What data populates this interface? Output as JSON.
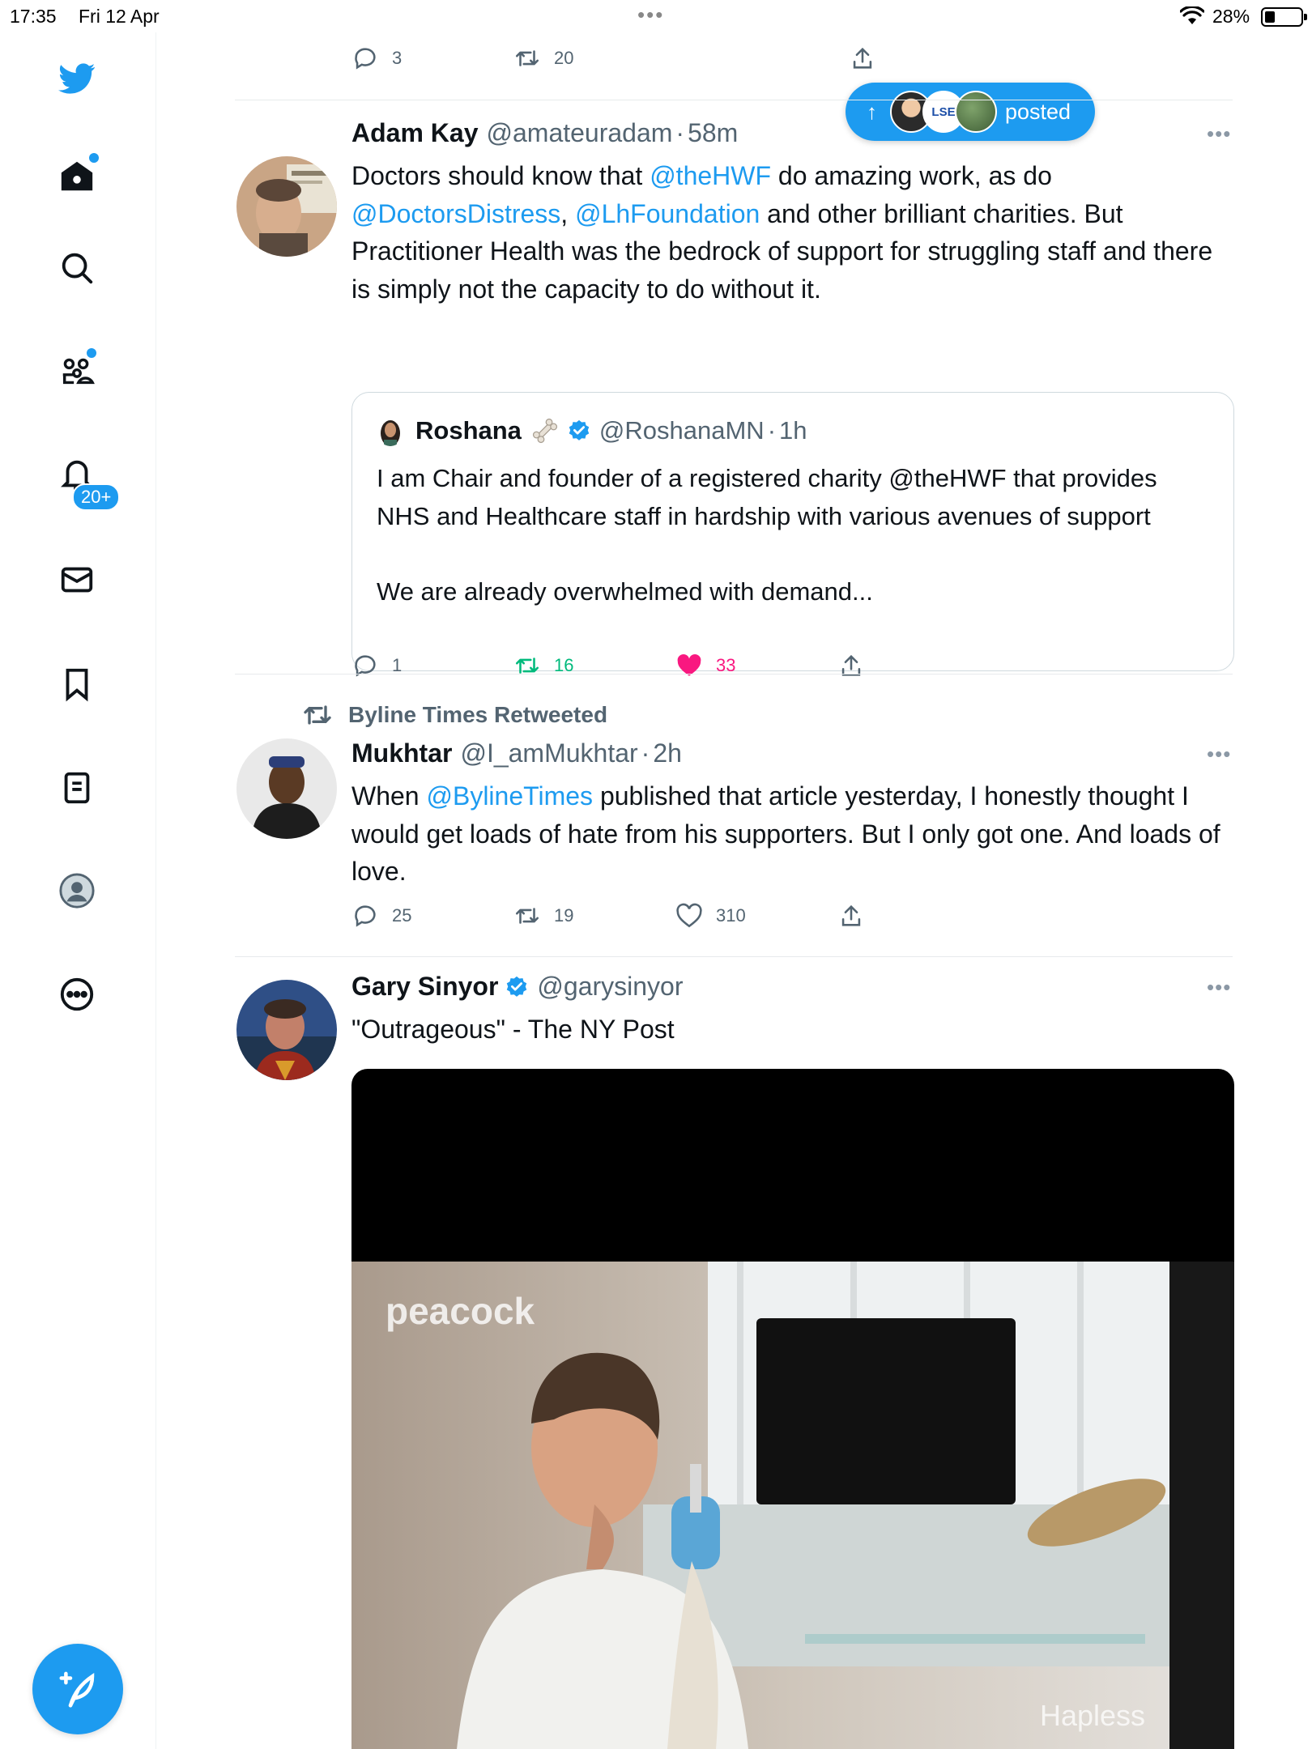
{
  "status_bar": {
    "time": "17:35",
    "date": "Fri 12 Apr",
    "battery": "28%",
    "battery_level": 0.28
  },
  "sidebar": {
    "nav": [
      "twitter-logo",
      "home",
      "explore",
      "communities",
      "notifications",
      "messages",
      "bookmarks",
      "lists",
      "profile",
      "more"
    ],
    "notifications_badge": "20+",
    "compose": "compose-tweet"
  },
  "top_actions": {
    "reply_count": "3",
    "retweet_count": "20"
  },
  "posted_pill": {
    "arrow": "↑",
    "label": "posted",
    "avatar_text": "LSE"
  },
  "tweets": [
    {
      "name": "Adam Kay",
      "handle": "@amateuradam",
      "sep": "·",
      "time": "58m",
      "text_segments": [
        "Doctors should know that ",
        "@theHWF",
        " do amazing work, as do ",
        "@DoctorsDistress",
        ", ",
        "@LhFoundation",
        " and other brilliant charities. But Practitioner Health was the bedrock of support for struggling staff and there is simply not the capacity to do without it."
      ],
      "quote": {
        "name": "Roshana",
        "handle": "@RoshanaMN",
        "sep": "·",
        "time": "1h",
        "text": "I am Chair and founder of a registered charity @theHWF that provides NHS and Healthcare staff in hardship with various avenues of support\n\nWe are already overwhelmed with demand..."
      },
      "replies": "1",
      "retweets": "16",
      "likes": "33"
    },
    {
      "retweeted_by": "Byline Times Retweeted",
      "name": "Mukhtar",
      "handle": "@I_amMukhtar",
      "sep": "·",
      "time": "2h",
      "text_segments": [
        "When ",
        "@BylineTimes",
        " published that article yesterday, I honestly thought I would get loads of hate from his supporters. But I only got one. And loads of love."
      ],
      "replies": "25",
      "retweets": "19",
      "likes": "310"
    },
    {
      "name": "Gary Sinyor",
      "handle": "@garysinyor",
      "text": "\"Outrageous\" - The NY Post",
      "media": {
        "watermark": "peacock",
        "corner_text": "Hapless"
      }
    }
  ],
  "colors": {
    "accent": "#1d9bf0",
    "retweet_active": "#00ba7c",
    "like_active": "#f91880",
    "muted": "#536471"
  }
}
